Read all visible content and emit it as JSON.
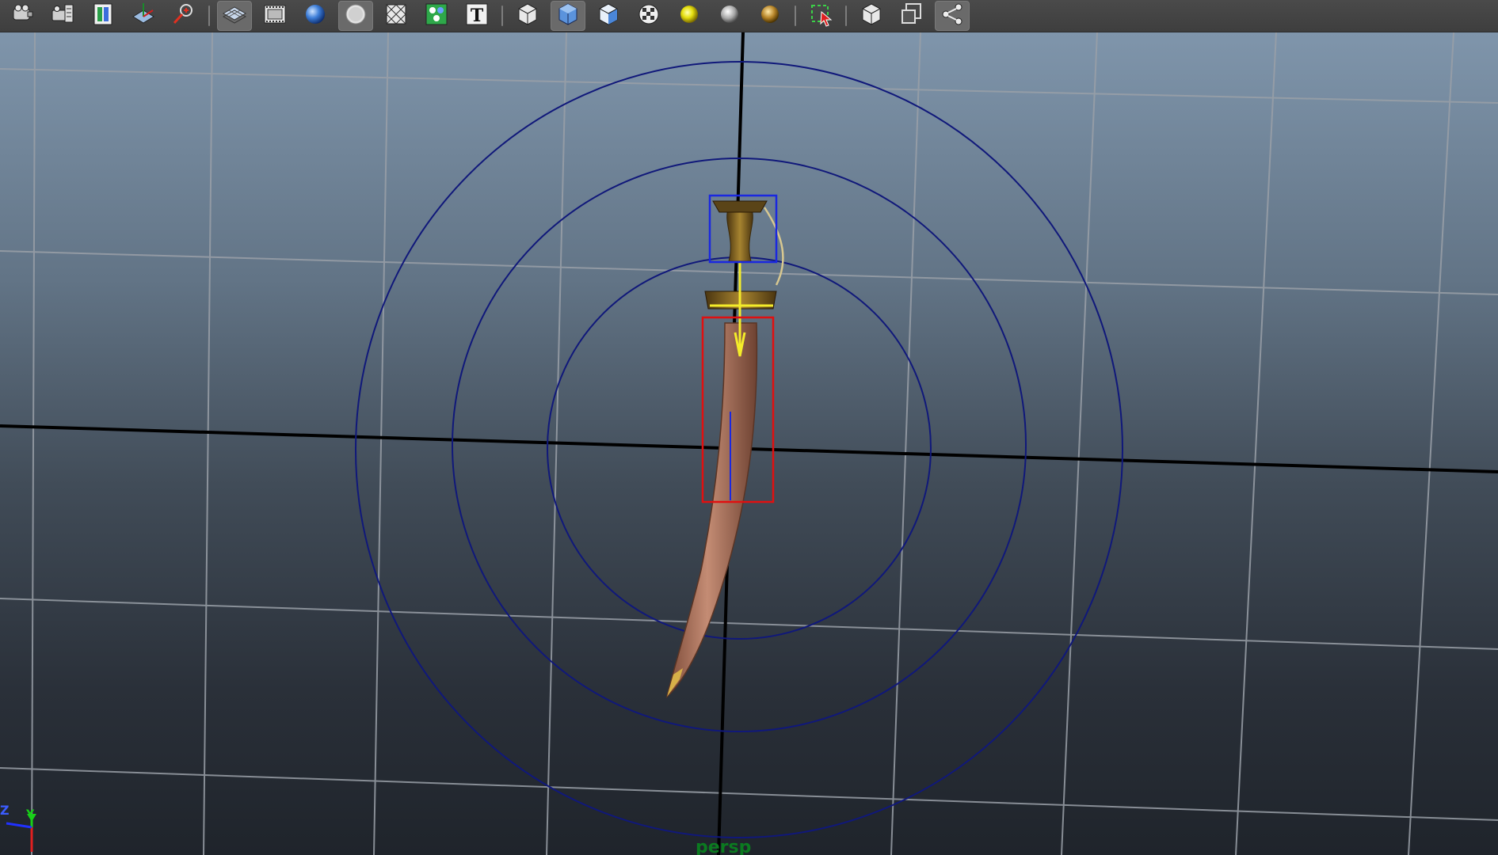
{
  "toolbar": {
    "buttons": [
      {
        "icon": "camera-attributes-icon"
      },
      {
        "icon": "bookmark-camera-icon"
      },
      {
        "icon": "image-plane-icon"
      },
      {
        "icon": "grid-display-icon"
      },
      {
        "icon": "camera-tools-icon"
      },
      {
        "icon": "wireframe-icon",
        "active": true
      },
      {
        "icon": "film-gate-icon"
      },
      {
        "icon": "smooth-shade-icon"
      },
      {
        "icon": "flat-shade-icon",
        "active": true
      },
      {
        "icon": "wireframe-on-shaded-icon"
      },
      {
        "icon": "textured-icon"
      },
      {
        "icon": "text-icon"
      },
      {
        "icon": "xray-icon"
      },
      {
        "icon": "bounding-box-shade-icon",
        "active": true
      },
      {
        "icon": "default-material-icon"
      },
      {
        "icon": "checker-texture-icon"
      },
      {
        "icon": "use-all-lights-icon"
      },
      {
        "icon": "shadows-icon"
      },
      {
        "icon": "gold-light-icon"
      },
      {
        "icon": "selection-highlight-icon"
      },
      {
        "icon": "isolate-select-icon"
      },
      {
        "icon": "frame-selection-icon"
      },
      {
        "icon": "share-icon"
      }
    ],
    "text_button_glyph": "T"
  },
  "viewport": {
    "camera_label": "persp",
    "axis_labels": {
      "z": "Z",
      "y": "Y"
    },
    "colors": {
      "grid": "#9a9ea4",
      "axis_line": "#000000",
      "manipulator_rings": "#10187a",
      "selection_box_red": "#e01010",
      "selection_box_blue": "#1a28e0",
      "sheath": "#b27a62",
      "hilt": "#8d6a1c"
    }
  }
}
